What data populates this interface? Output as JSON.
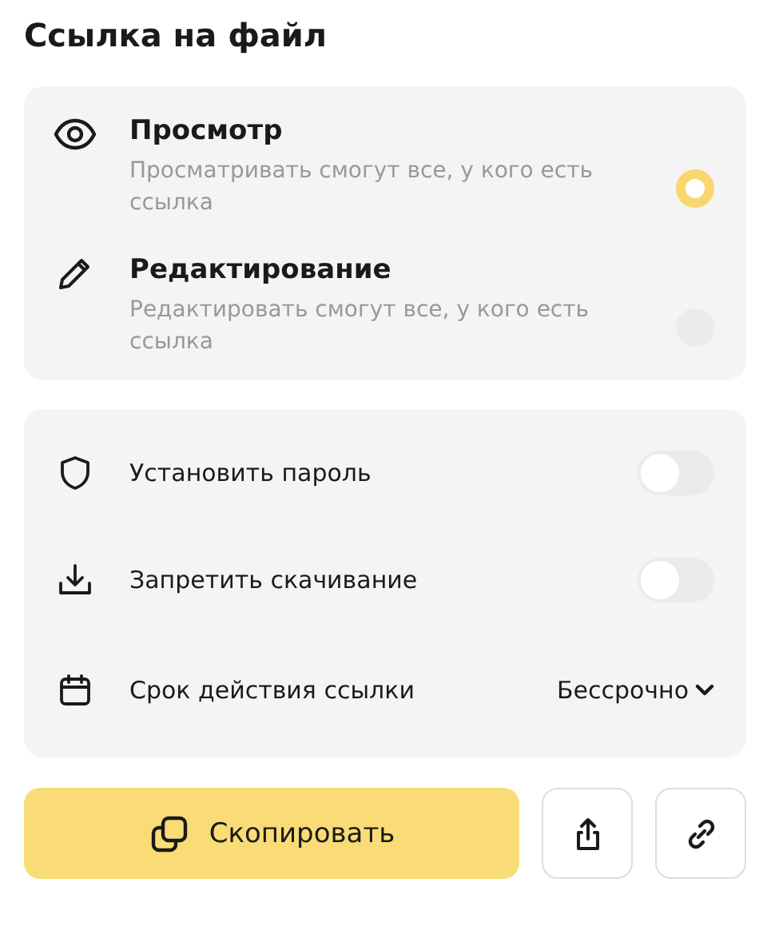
{
  "title": "Ссылка на файл",
  "access_options": [
    {
      "kind": "view",
      "label": "Просмотр",
      "description": "Просматривать смогут все, у кого есть ссылка",
      "selected": true
    },
    {
      "kind": "edit",
      "label": "Редактирование",
      "description": "Редактировать смогут все, у кого есть ссылка",
      "selected": false
    }
  ],
  "settings": [
    {
      "kind": "password",
      "label": "Установить пароль",
      "on": false
    },
    {
      "kind": "download",
      "label": "Запретить скачивание",
      "on": false
    },
    {
      "kind": "expiry",
      "label": "Срок действия ссылки",
      "value": "Бессрочно"
    }
  ],
  "copy_button": {
    "label": "Скопировать"
  }
}
